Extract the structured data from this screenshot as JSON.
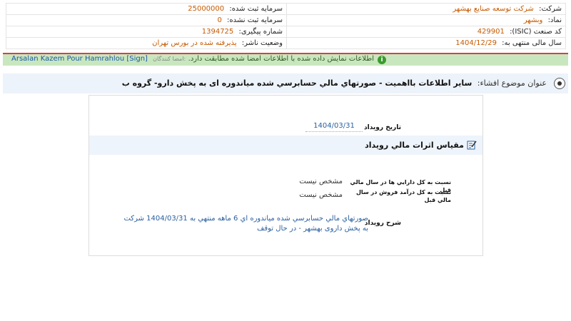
{
  "header": {
    "company_label": "شرکت:",
    "company_value": "شرکت توسعه صنایع بهشهر",
    "capital_label": "سرمایه ثبت شده:",
    "capital_value": "25000000",
    "symbol_label": "نماد:",
    "symbol_value": "وبشهر",
    "unregistered_label": "سرمایه ثبت نشده:",
    "unregistered_value": "0",
    "isic_label": "کد صنعت (ISIC):",
    "isic_value": "429901",
    "tracking_label": "شماره پیگیری:",
    "tracking_value": "1394725",
    "fiscal_label": "سال مالی منتهی به:",
    "fiscal_value": "1404/12/29",
    "status_label": "وضعیت ناشر:",
    "status_value": "پذیرفته شده در بورس تهران"
  },
  "status_bar": {
    "message": "اطلاعات نمایش داده شده با اطلاعات امضا شده مطابقت دارد.",
    "signers_label": "امضا کنندگان:",
    "signers_value": "Arsalan Kazem Pour Hamrahlou [Sign]",
    "colors": {
      "bar": "#c9e7bf",
      "accent": "#d84040"
    }
  },
  "title": {
    "label": "عنوان موضوع افشاء:",
    "text": "ساير اطلاعات بااهميت - صورتهاي مالي حسابرسي شده مياندوره ای به پخش دارو- گروه ب"
  },
  "event": {
    "date_label": "تاريخ رويداد",
    "date_value": "1404/03/31"
  },
  "section": {
    "title": "مقياس اثرات مالي رويداد",
    "icon": "edit-note-icon"
  },
  "rows": [
    {
      "label": "نسبت به کل دارايي ها در سال مالي قبل",
      "value": "مشخص نيست"
    },
    {
      "label": "نسبت به کل درآمد فروش در سال مالي قبل",
      "value": "مشخص نيست"
    }
  ],
  "description": {
    "label": "شرح رويداد",
    "value": "صورتهاي مالي حسابرسي شده مياندوره اي 6 ماهه منتهي به 1404/03/31 شرکت به پخش داروی بهشهر - در حال توقف"
  }
}
